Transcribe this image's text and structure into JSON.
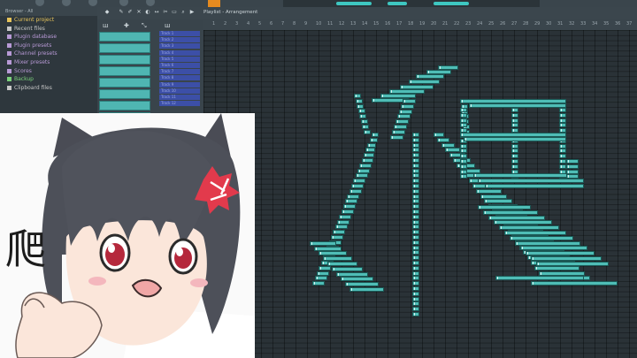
{
  "app": {
    "accent": "#3ec7c1",
    "note_color": "#4fbdb6",
    "pattern_color": "#4fb6b2",
    "track_color": "#3c4fa7"
  },
  "browser": {
    "title": "Browser - All",
    "items": [
      {
        "label": "Current project",
        "icon": "project-icon",
        "color": "#e6c35a"
      },
      {
        "label": "Recent files",
        "icon": "folder-icon",
        "color": "#c7c7c7"
      },
      {
        "label": "Plugin database",
        "icon": "database-icon",
        "color": "#b89ad6"
      },
      {
        "label": "Plugin presets",
        "icon": "preset-icon",
        "color": "#b89ad6"
      },
      {
        "label": "Channel presets",
        "icon": "preset-icon",
        "color": "#b89ad6"
      },
      {
        "label": "Mixer presets",
        "icon": "preset-icon",
        "color": "#b89ad6"
      },
      {
        "label": "Scores",
        "icon": "note-icon",
        "color": "#b89ad6"
      },
      {
        "label": "Backup",
        "icon": "backup-icon",
        "color": "#7bd07b"
      },
      {
        "label": "Clipboard files",
        "icon": "clipboard-icon",
        "color": "#c7c7c7"
      }
    ]
  },
  "playlist": {
    "title": "Playlist - Arrangement",
    "tracks": [
      "Track 1",
      "Track 2",
      "Track 3",
      "Track 4",
      "Track 5",
      "Track 6",
      "Track 7",
      "Track 8",
      "Track 9",
      "Track 10",
      "Track 11",
      "Track 12"
    ],
    "ruler": [
      "1",
      "2",
      "3",
      "4",
      "5",
      "6",
      "7",
      "8",
      "9",
      "10",
      "11",
      "12",
      "13",
      "14",
      "15",
      "16",
      "17",
      "18",
      "19",
      "20",
      "21",
      "22",
      "23",
      "24",
      "25",
      "26",
      "27",
      "28",
      "29",
      "30",
      "31",
      "32",
      "33",
      "34",
      "35",
      "36",
      "37",
      "38"
    ]
  },
  "sticker": {
    "text": "爬",
    "icon": "anime-girl-sticker"
  }
}
